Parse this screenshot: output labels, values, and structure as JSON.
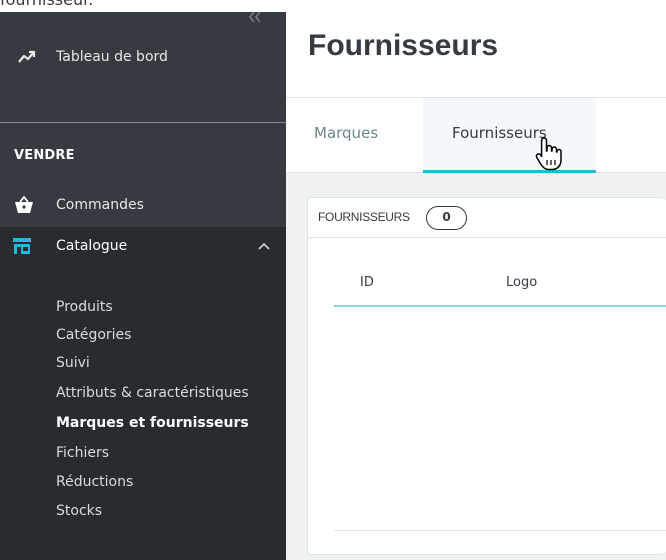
{
  "top_partial_text": "fournisseur.",
  "sidebar": {
    "dashboard_label": "Tableau de bord",
    "section_label": "VENDRE",
    "orders_label": "Commandes",
    "catalog_label": "Catalogue",
    "submenu": [
      "Produits",
      "Catégories",
      "Suivi",
      "Attributs & caractéristiques",
      "Marques et fournisseurs",
      "Fichiers",
      "Réductions",
      "Stocks"
    ],
    "active_submenu_index": 4
  },
  "header": {
    "title": "Fournisseurs"
  },
  "tabs": {
    "brands_label": "Marques",
    "suppliers_label": "Fournisseurs",
    "active": "suppliers"
  },
  "panel": {
    "title": "FOURNISSEURS",
    "count": "0",
    "columns": {
      "id": "ID",
      "logo": "Logo"
    }
  },
  "colors": {
    "sidebar_bg": "#363a41",
    "sidebar_active_bg": "#282b30",
    "accent": "#25b9d7",
    "text_dark": "#363a41",
    "tab_inactive": "#6c868e"
  },
  "icons": {
    "dashboard": "trending-up-icon",
    "orders": "shopping-basket-icon",
    "catalog": "store-icon",
    "catalog_toggle": "chevron-up-icon",
    "sidebar_collapse": "double-chevron-left-icon",
    "cursor": "hand-pointer-icon"
  }
}
